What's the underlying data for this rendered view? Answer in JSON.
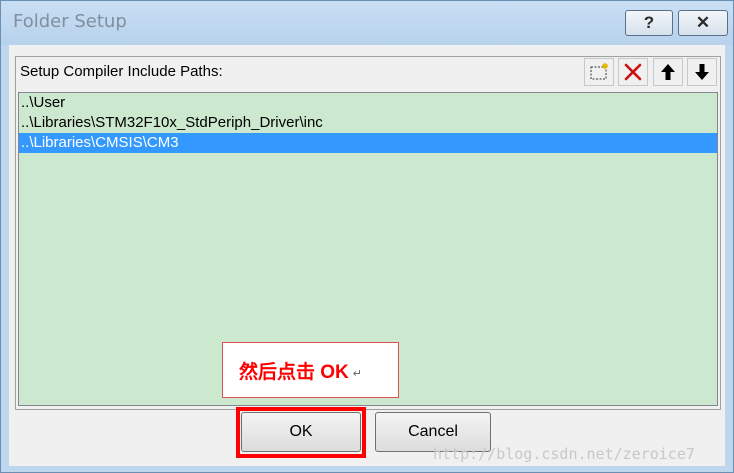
{
  "window": {
    "title": "Folder Setup",
    "help_label": "?",
    "close_label": "✕"
  },
  "group": {
    "label": "Setup Compiler Include Paths:",
    "tools": [
      "new-folder-icon",
      "delete-icon",
      "move-up-icon",
      "move-down-icon"
    ]
  },
  "paths": [
    "..\\User",
    "..\\Libraries\\STM32F10x_StdPeriph_Driver\\inc",
    "..\\Libraries\\CMSIS\\CM3"
  ],
  "selected_index": 2,
  "annotation": {
    "text": "然后点击 OK",
    "mark": "↵"
  },
  "buttons": {
    "ok": "OK",
    "cancel": "Cancel"
  },
  "watermark": "http://blog.csdn.net/zeroice7",
  "colors": {
    "list_bg": "#cce8cf",
    "selection": "#3399ff",
    "highlight": "#ff0000"
  }
}
